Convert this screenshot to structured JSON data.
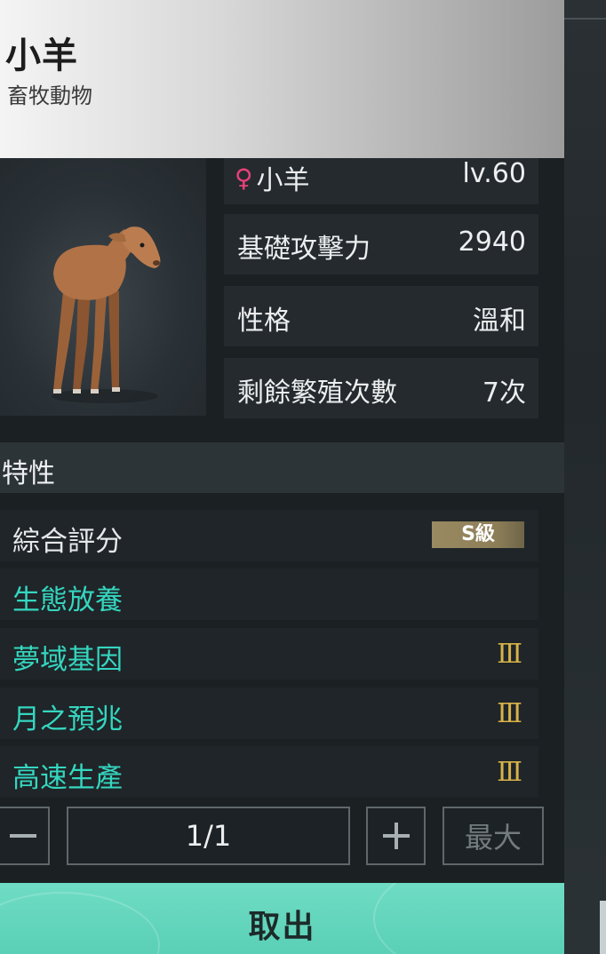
{
  "header": {
    "name": "小羊",
    "category": "畜牧動物"
  },
  "info": {
    "name": "小羊",
    "gender_icon": "female-icon",
    "level": "lv.60",
    "stats": [
      {
        "label": "基礎攻擊力",
        "value": "2940"
      },
      {
        "label": "性格",
        "value": "溫和"
      },
      {
        "label": "剩餘繁殖次數",
        "value": "7次"
      }
    ]
  },
  "traits": {
    "title": "特性",
    "rating_label": "綜合評分",
    "rating_value": "S級",
    "items": [
      {
        "label": "生態放養",
        "rank": ""
      },
      {
        "label": "夢域基因",
        "rank": "Ⅲ"
      },
      {
        "label": "月之預兆",
        "rank": "Ⅲ"
      },
      {
        "label": "高速生產",
        "rank": "Ⅲ"
      }
    ]
  },
  "quantity": {
    "value": "1/1",
    "max_label": "最大"
  },
  "action": {
    "take_out_label": "取出"
  },
  "colors": {
    "accent": "#5ad0b6",
    "trait_text": "#35d6c0",
    "rank_gold": "#d7b24a",
    "female": "#e8417a"
  }
}
